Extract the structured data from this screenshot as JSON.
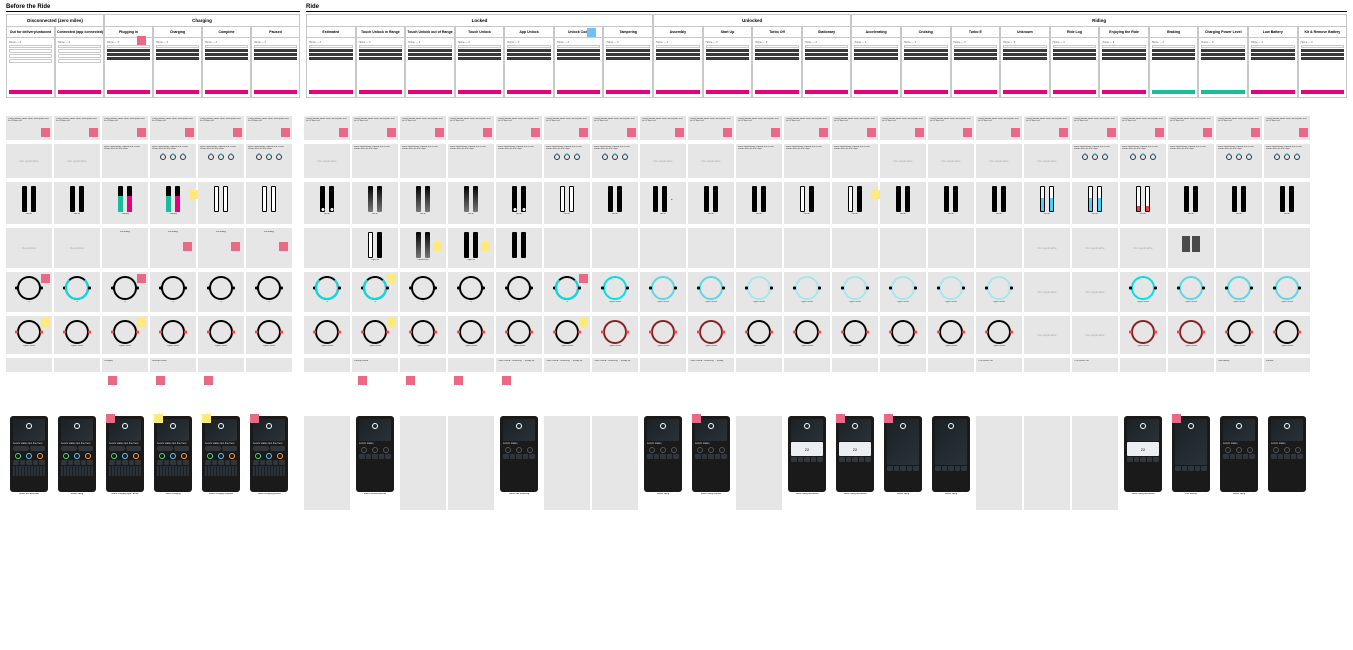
{
  "sections": {
    "before": "Before the Ride",
    "ride": "Ride"
  },
  "groups": {
    "disconnected": "Disconnected (zero miles)",
    "charging": "Charging",
    "locked": "Locked",
    "unlocked": "Unlocked",
    "riding": "Riding"
  },
  "states": {
    "before": [
      "Out for delivery/unboxed",
      "Connected (app connected)",
      "Plugging in",
      "Charging",
      "Complete",
      "Paused"
    ],
    "locked": [
      "Estimated",
      "Touch Unlock in Range",
      "Touch Unlock out of Range",
      "Touch Unlock",
      "App Unlock",
      "Unlock Code",
      "Tampering"
    ],
    "unlocked": [
      "Assembly",
      "Start Up",
      "Turbo Off",
      "Stationary"
    ],
    "riding": [
      "Accelerating",
      "Cruising",
      "Turbo E",
      "Unknown",
      "Ride Log",
      "Enjoying the Ride",
      "Braking",
      "Charging Power Level",
      "Low Battery",
      "Kit & Remove Battery"
    ]
  },
  "wf_tag": "Home — 3",
  "captions": {
    "na": "Not applicable",
    "off": "All off",
    "idle": "Idle off",
    "chg": "Charging",
    "rec": "Recording",
    "light_off": "Light off",
    "dim": "Dimmed on",
    "lights_on": "Lights on/off",
    "pulse": "Pulsating slow/fast light",
    "speed": "Light scroll speed",
    "tamper": "Tampering",
    "anim": "Animation",
    "ring_off": "Off",
    "ring_ready": "Lights on/off",
    "braking": "Braking",
    "startup": "Start-up sound",
    "locking": "Locking sound",
    "unlock": "Timer sound / Unlocking → Ready for",
    "lowbat": "Low battery",
    "soundoff": "Tick sound / off",
    "ph_disc": "Status disconnected",
    "ph_conn": "Status riding",
    "ph_chg": "Status charging light / Active",
    "ph_chgq": "Status charging",
    "ph_done": "Status charging complete",
    "ph_paused": "Status charging paused",
    "ph_locked": "Status locked/unlocked",
    "ph_locked2": "Status ride unlocking",
    "ph_ride": "Status riding",
    "ph_ridealt": "Status riding variants",
    "ph_dash": "Status riding dashboard",
    "ph_lowbat": "Low battery"
  },
  "labels": {
    "speed": "22"
  }
}
